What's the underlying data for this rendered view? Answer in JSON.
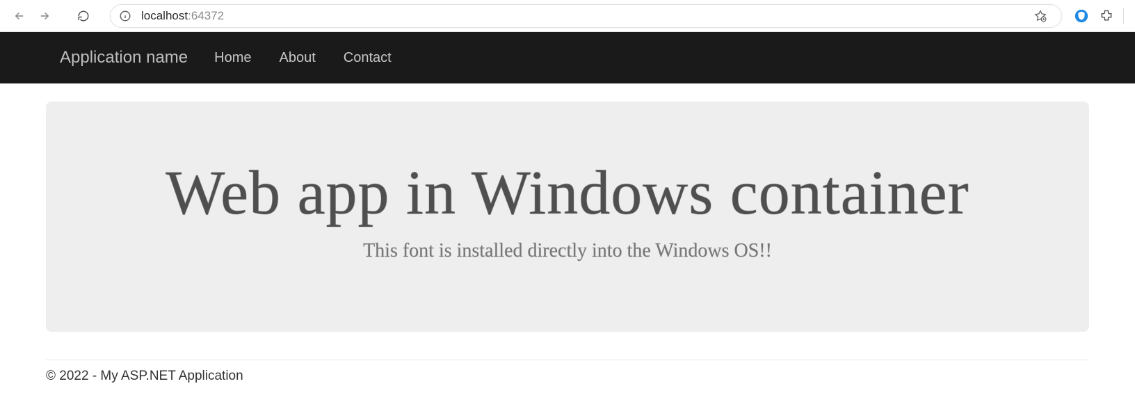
{
  "browser": {
    "url_host": "localhost",
    "url_port": ":64372"
  },
  "navbar": {
    "brand": "Application name",
    "links": [
      "Home",
      "About",
      "Contact"
    ]
  },
  "hero": {
    "title": "Web app in Windows container",
    "subtitle": "This font is installed directly into the Windows OS!!"
  },
  "footer": {
    "text": "© 2022 - My ASP.NET Application"
  }
}
